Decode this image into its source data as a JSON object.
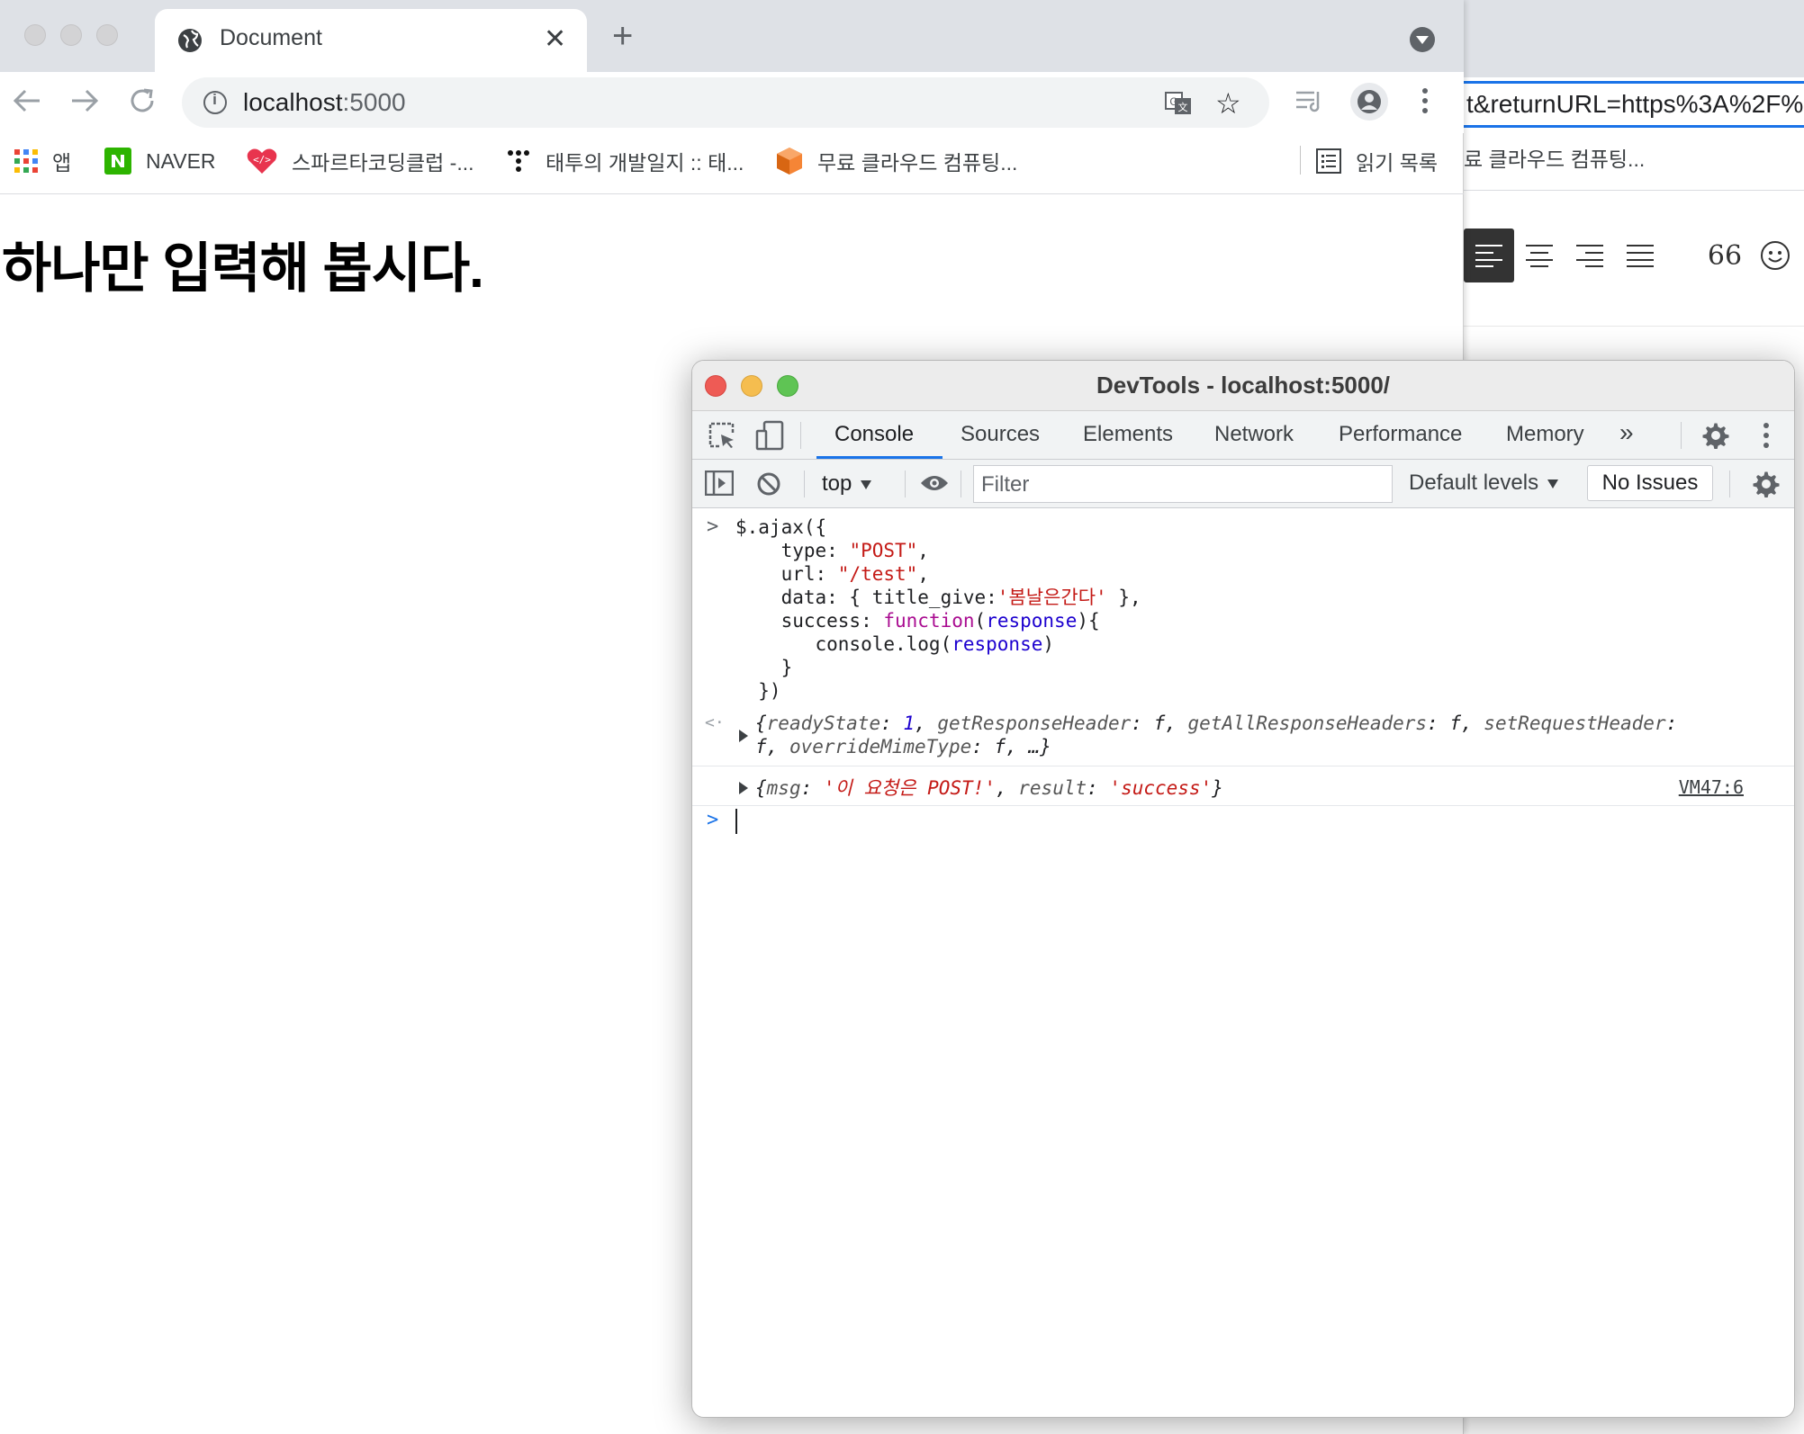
{
  "background_window": {
    "url_fragment": "t&returnURL=https%3A%2F%",
    "bookmark_fragment": "료 클라우드 컴퓨팅...",
    "toolbar_quote": "66"
  },
  "browser": {
    "tab_title": "Document",
    "url_host": "localhost",
    "url_port": ":5000",
    "bookmarks": [
      {
        "label": "앱",
        "icon": "apps-grid-icon"
      },
      {
        "label": "NAVER",
        "icon": "naver-icon"
      },
      {
        "label": "스파르타코딩클럽 -...",
        "icon": "sparta-icon"
      },
      {
        "label": "태투의 개발일지 :: 태...",
        "icon": "tistory-icon"
      },
      {
        "label": "무료 클라우드 컴퓨팅...",
        "icon": "aws-icon"
      }
    ],
    "reading_list": "읽기 목록"
  },
  "page": {
    "heading": "하나만 입력해 봅시다."
  },
  "devtools": {
    "title": "DevTools - localhost:5000/",
    "tabs": [
      "Console",
      "Sources",
      "Elements",
      "Network",
      "Performance",
      "Memory"
    ],
    "more_tabs": "»",
    "context": "top",
    "filter_placeholder": "Filter",
    "levels": "Default levels",
    "issues": "No Issues",
    "console": {
      "input_lines": {
        "l1": "$.ajax({",
        "l2_key": "    type: ",
        "l2_val": "\"POST\"",
        "l2_end": ",",
        "l3_key": "    url: ",
        "l3_val": "\"/test\"",
        "l3_end": ",",
        "l4_pre": "    data: { title_give:",
        "l4_val": "'봄날은간다'",
        "l4_end": " },",
        "l5_pre": "    success: ",
        "l5_kw": "function",
        "l5_p1": "(",
        "l5_arg": "response",
        "l5_p2": "){",
        "l6_pre": "       console.log(",
        "l6_arg": "response",
        "l6_end": ")",
        "l7": "    }",
        "l8": "  })"
      },
      "result_line1": {
        "open": "{",
        "k1": "readyState",
        "v1": "1",
        "k2": "getResponseHeader",
        "k3": "getAllResponseHeaders",
        "k4": "setRequestHeader",
        "f": "f"
      },
      "result_line2": {
        "f": "f",
        "k5": "overrideMimeType",
        "tail": "…}"
      },
      "log": {
        "open": "{",
        "k1": "msg",
        "v1": "'이 요청은 POST!'",
        "k2": "result",
        "v2": "'success'",
        "close": "}",
        "source": "VM47:6"
      }
    }
  },
  "colors": {
    "accent": "#1a73e8",
    "string": "#c41a16",
    "keyword": "#aa0d91",
    "number": "#1c00cf",
    "close_light": "#ee5b55",
    "min_light": "#f5bd4f",
    "max_light": "#5fc454"
  }
}
